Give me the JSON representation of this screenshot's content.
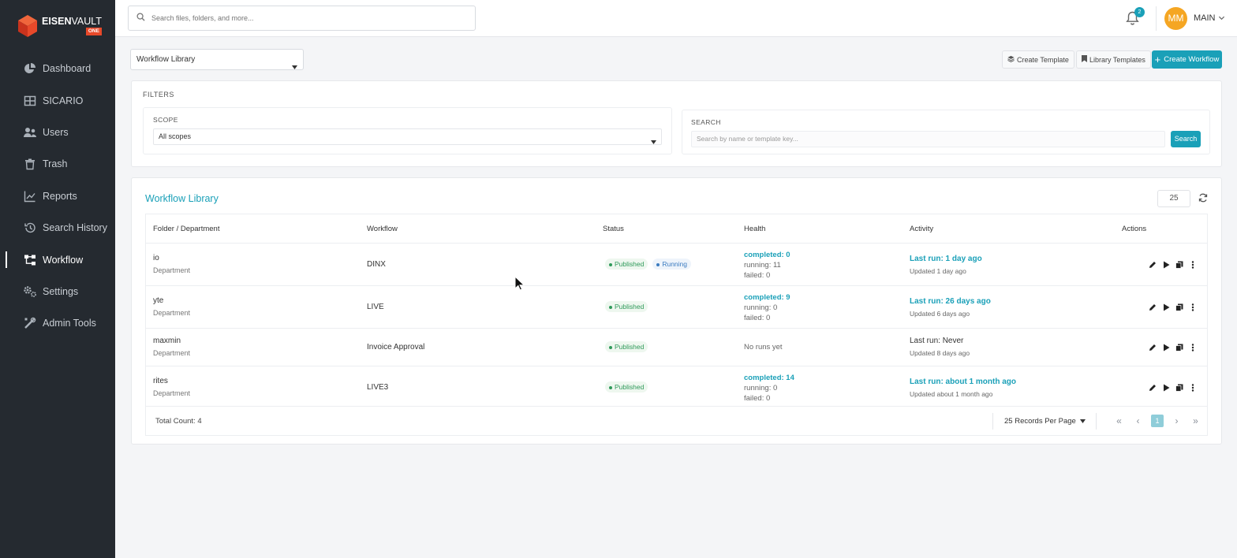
{
  "brand": {
    "name_bold": "EISEN",
    "name_light": "VAULT",
    "tag": "ONE"
  },
  "sidebar": {
    "items": [
      {
        "label": "Dashboard",
        "icon": "pie-chart-icon"
      },
      {
        "label": "SICARIO",
        "icon": "grid-icon"
      },
      {
        "label": "Users",
        "icon": "users-icon"
      },
      {
        "label": "Trash",
        "icon": "trash-icon"
      },
      {
        "label": "Reports",
        "icon": "line-chart-icon"
      },
      {
        "label": "Search History",
        "icon": "history-icon"
      },
      {
        "label": "Workflow",
        "icon": "workflow-icon",
        "active": true
      },
      {
        "label": "Settings",
        "icon": "gears-icon"
      },
      {
        "label": "Admin Tools",
        "icon": "tools-icon"
      }
    ]
  },
  "topbar": {
    "search_placeholder": "Search files, folders, and more...",
    "notification_count": "2",
    "avatar_initials": "MM",
    "user_label": "MAIN"
  },
  "toolbar": {
    "view_select": "Workflow Library",
    "create_template": "Create Template",
    "library_templates": "Library Templates",
    "create_workflow": "Create Workflow"
  },
  "filters": {
    "title": "FILTERS",
    "scope_label": "SCOPE",
    "scope_value": "All scopes",
    "search_label": "SEARCH",
    "search_placeholder": "Search by name or template key...",
    "search_button": "Search"
  },
  "library": {
    "title": "Workflow Library",
    "page_size": "25",
    "columns": [
      "Folder / Department",
      "Workflow",
      "Status",
      "Health",
      "Activity",
      "Actions"
    ],
    "rows": [
      {
        "folder": "io",
        "type": "Department",
        "workflow": "DINX",
        "statuses": [
          "Published",
          "Running"
        ],
        "completed": "completed: 0",
        "running": "running: 11",
        "failed": "failed: 0",
        "no_runs": "",
        "last_run": "Last run: 1 day ago",
        "updated": "Updated 1 day ago",
        "last_run_plain": false
      },
      {
        "folder": "yte",
        "type": "Department",
        "workflow": "LIVE",
        "statuses": [
          "Published"
        ],
        "completed": "completed: 9",
        "running": "running: 0",
        "failed": "failed: 0",
        "no_runs": "",
        "last_run": "Last run: 26 days ago",
        "updated": "Updated 6 days ago",
        "last_run_plain": false
      },
      {
        "folder": "maxmin",
        "type": "Department",
        "workflow": "Invoice Approval",
        "statuses": [
          "Published"
        ],
        "completed": "",
        "running": "",
        "failed": "",
        "no_runs": "No runs yet",
        "last_run": "Last run: Never",
        "updated": "Updated 8 days ago",
        "last_run_plain": true
      },
      {
        "folder": "rites",
        "type": "Department",
        "workflow": "LIVE3",
        "statuses": [
          "Published"
        ],
        "completed": "completed: 14",
        "running": "running: 0",
        "failed": "failed: 0",
        "no_runs": "",
        "last_run": "Last run: about 1 month ago",
        "updated": "Updated about 1 month ago",
        "last_run_plain": false
      }
    ],
    "total": "Total Count: 4",
    "records_per_page": "25 Records Per Page",
    "current_page": "1"
  },
  "colors": {
    "accent": "#1aa0b8",
    "sidebar": "#252a30",
    "avatar": "#f5a623",
    "brand_orange": "#e8492a"
  }
}
